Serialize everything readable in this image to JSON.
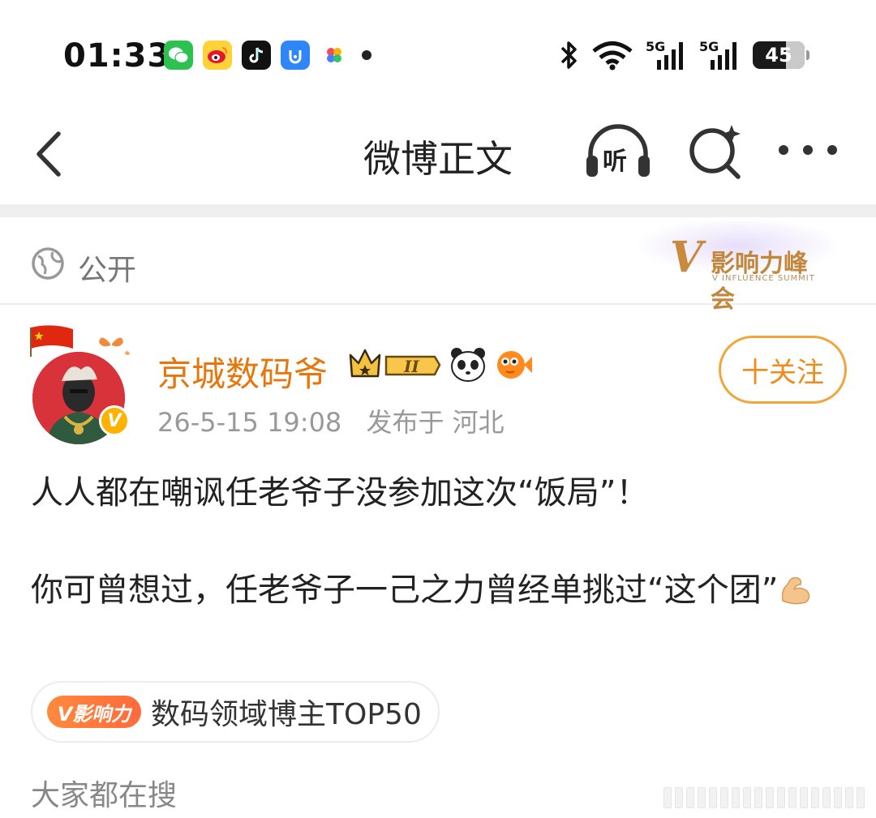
{
  "status_bar": {
    "time": "01:33",
    "apps": [
      "wechat-icon",
      "weibo-icon",
      "tiktok-icon",
      "helper-app-icon",
      "pinwheel-icon"
    ],
    "network_1": "5G",
    "network_2": "5G",
    "battery": "45"
  },
  "nav": {
    "title": "微博正文",
    "listen_label": "听"
  },
  "visibility": {
    "label": "公开"
  },
  "summit_badge": {
    "mark": "V",
    "title": "影响力峰会",
    "subtitle": "V INFLUENCE SUMMIT"
  },
  "author": {
    "name": "京城数码爷",
    "level": "II",
    "verified_mark": "V",
    "time": "26-5-15 19:08",
    "location": "发布于 河北",
    "follow_label": "十关注"
  },
  "post": {
    "paragraph_1": "人人都在嘲讽任老爷子没参加这次“饭局”！",
    "paragraph_2": "你可曾想过，任老爷子一己之力曾经单挑过“这个团”"
  },
  "influence_tag": {
    "badge": "V影响力",
    "text": "数码领域博主TOP50"
  },
  "section": {
    "everyone_searching": "大家都在搜"
  },
  "colors": {
    "accent_orange": "#e8760b",
    "follow_border": "#f2a53b",
    "muted_text": "#999999"
  }
}
